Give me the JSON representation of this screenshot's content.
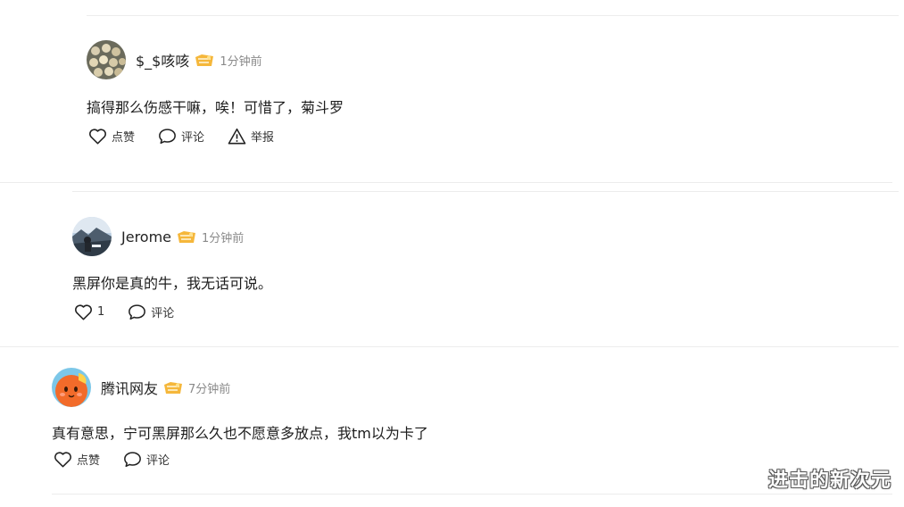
{
  "comments": [
    {
      "username": "$_$咳咳",
      "time": "1分钟前",
      "content": "搞得那么伤感干嘛，唉！可惜了，菊斗罗",
      "like_label": "点赞",
      "comment_label": "评论",
      "report_label": "举报"
    },
    {
      "username": "Jerome",
      "time": "1分钟前",
      "content": "黑屏你是真的牛，我无话可说。",
      "like_label": "1",
      "comment_label": "评论"
    },
    {
      "username": "腾讯网友",
      "time": "7分钟前",
      "content": "真有意思，宁可黑屏那么久也不愿意多放点，我tm以为卡了",
      "like_label": "点赞",
      "comment_label": "评论"
    }
  ],
  "watermark": "进击的新次元",
  "icons": {
    "vip": "vip-badge-icon",
    "like": "heart-outline-icon",
    "comment": "speech-bubble-icon",
    "report": "warning-triangle-icon"
  },
  "colors": {
    "vip_badge": "#f5b73b",
    "time": "#8a8a8a",
    "separator": "#ececec"
  }
}
